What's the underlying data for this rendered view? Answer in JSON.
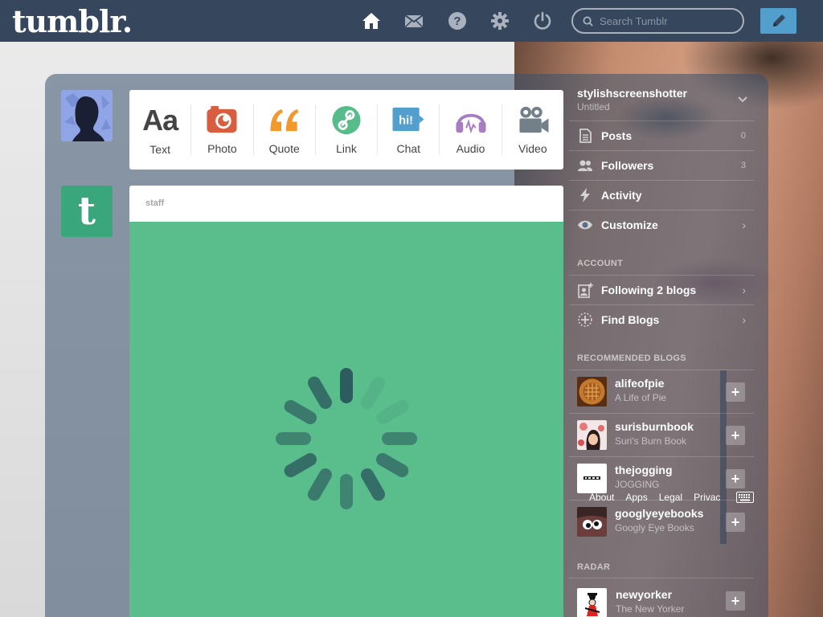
{
  "app": {
    "logo": "tumblr."
  },
  "nav": {
    "search_placeholder": "Search Tumblr",
    "icons": [
      "home-icon",
      "mail-icon",
      "help-icon",
      "gear-icon",
      "power-icon",
      "pencil-icon"
    ]
  },
  "post_types": [
    {
      "label": "Text",
      "icon": "text-icon",
      "glyph": "Aa",
      "color": "#444444"
    },
    {
      "label": "Photo",
      "icon": "camera-icon",
      "color": "#d95e40"
    },
    {
      "label": "Quote",
      "icon": "quote-icon",
      "glyph": "“",
      "color": "#f2992e"
    },
    {
      "label": "Link",
      "icon": "link-icon",
      "color": "#56bc8a"
    },
    {
      "label": "Chat",
      "icon": "chat-icon",
      "glyph": "hi!",
      "color": "#529ecc"
    },
    {
      "label": "Audio",
      "icon": "headphones-icon",
      "color": "#a77dc2"
    },
    {
      "label": "Video",
      "icon": "video-camera-icon",
      "color": "#748089"
    }
  ],
  "post": {
    "author": "staff",
    "accent": "#59bd8c"
  },
  "sidebar": {
    "blog": {
      "name": "stylishscreenshotter",
      "subtitle": "Untitled"
    },
    "items": [
      {
        "label": "Posts",
        "icon": "posts-icon",
        "count": "0"
      },
      {
        "label": "Followers",
        "icon": "followers-icon",
        "count": "3"
      },
      {
        "label": "Activity",
        "icon": "lightning-icon",
        "count": ""
      },
      {
        "label": "Customize",
        "icon": "eye-icon",
        "count": "›"
      }
    ],
    "account_heading": "ACCOUNT",
    "account_items": [
      {
        "label": "Following 2 blogs",
        "icon": "following-icon"
      },
      {
        "label": "Find Blogs",
        "icon": "compass-icon"
      }
    ],
    "recommended_heading": "RECOMMENDED BLOGS",
    "recommended": [
      {
        "name": "alifeofpie",
        "title": "A Life of Pie",
        "color": "#b36b2a"
      },
      {
        "name": "surisburnbook",
        "title": "Suri's Burn Book",
        "color": "#c44a4a"
      },
      {
        "name": "thejogging",
        "title": "JOGGING",
        "color": "#ffffff"
      },
      {
        "name": "googlyeyebooks",
        "title": "Googly Eye Books",
        "color": "#6b3d3d"
      }
    ],
    "radar_heading": "RADAR",
    "radar": {
      "name": "newyorker",
      "title": "The New Yorker"
    }
  },
  "footer": {
    "links": [
      "About",
      "Apps",
      "Legal",
      "Privac"
    ]
  }
}
